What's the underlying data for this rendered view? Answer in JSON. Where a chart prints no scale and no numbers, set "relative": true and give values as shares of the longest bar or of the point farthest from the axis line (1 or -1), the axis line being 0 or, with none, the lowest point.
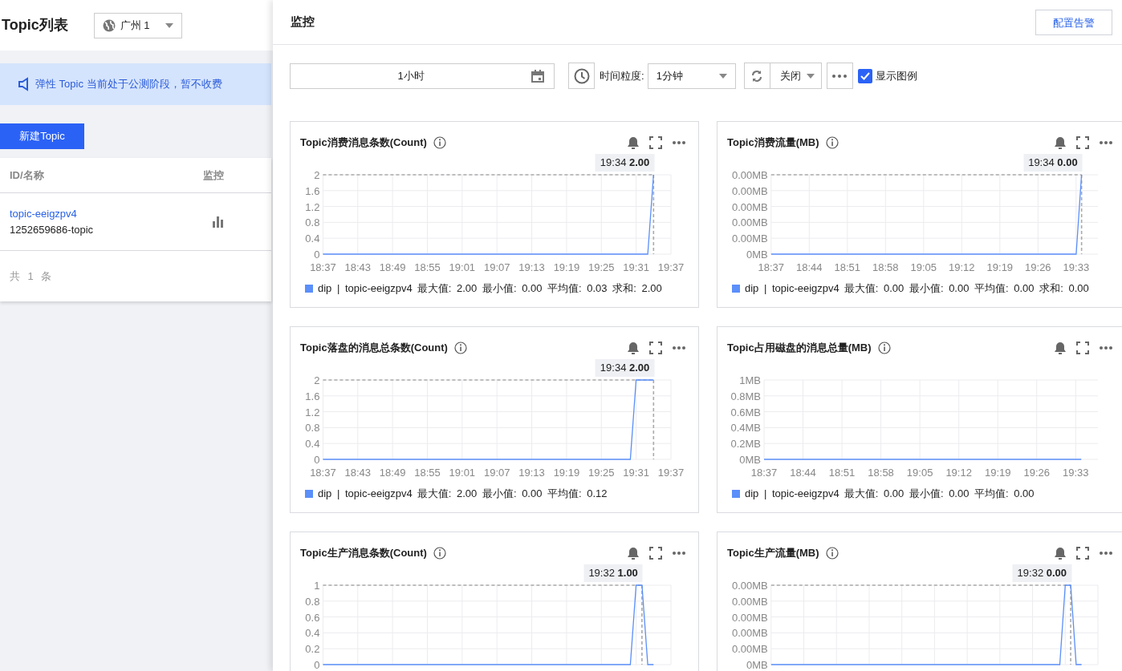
{
  "list_panel": {
    "title": "Topic列表",
    "region_select": {
      "value": "广州 1"
    },
    "notice": "弹性 Topic 当前处于公测阶段，暂不收费",
    "create_button": "新建Topic",
    "table": {
      "columns": [
        "ID/名称",
        "监控"
      ],
      "rows": [
        {
          "id": "topic-eeigzpv4",
          "name": "1252659686-topic"
        }
      ],
      "footer": "共 1 条"
    }
  },
  "monitor_panel": {
    "title": "监控",
    "alarm_button": "配置告警",
    "toolbar": {
      "time_range": "1小时",
      "granularity_label": "时间粒度:",
      "granularity": "1分钟",
      "refresh": "关闭",
      "show_legend": {
        "label": "显示图例",
        "checked": true
      }
    },
    "charts": [
      {
        "title": "Topic消费消息条数(Count)",
        "legend_stats": "最大值: 2.00 最小值: 0.00 平均值: 0.03 求和: 2.00",
        "chart_data": {
          "type": "line",
          "grid": true,
          "ylim": [
            0,
            2
          ],
          "yticks": [
            0,
            0.4,
            0.8,
            1.2,
            1.6,
            2
          ],
          "annotations": [
            "19:34 **2.00**"
          ],
          "categories": [
            "18:37",
            null,
            null,
            null,
            null,
            null,
            "18:43",
            null,
            null,
            null,
            null,
            null,
            "18:49",
            null,
            null,
            null,
            null,
            null,
            "18:55",
            null,
            null,
            null,
            null,
            null,
            "19:01",
            null,
            null,
            null,
            null,
            null,
            "19:07",
            null,
            null,
            null,
            null,
            null,
            "19:13",
            null,
            null,
            null,
            null,
            null,
            "19:19",
            null,
            null,
            null,
            null,
            null,
            "19:25",
            null,
            null,
            null,
            null,
            null,
            "19:31",
            null,
            null,
            null,
            null,
            null,
            "19:37"
          ],
          "series": [
            {
              "name": "dip | topic-eeigzpv4",
              "color": "#5b8ff9",
              "values": [
                0,
                0,
                0,
                0,
                0,
                0,
                0,
                0,
                0,
                0,
                0,
                0,
                0,
                0,
                0,
                0,
                0,
                0,
                0,
                0,
                0,
                0,
                0,
                0,
                0,
                0,
                0,
                0,
                0,
                0,
                0,
                0,
                0,
                0,
                0,
                0,
                0,
                0,
                0,
                0,
                0,
                0,
                0,
                0,
                0,
                0,
                0,
                0,
                0,
                0,
                0,
                0,
                0,
                0,
                0,
                0,
                0,
                2,
                null,
                null,
                null
              ]
            }
          ]
        }
      },
      {
        "title": "Topic消费流量(MB)",
        "legend_stats": "最大值: 0.00 最小值: 0.00 平均值: 0.00 求和: 0.00",
        "y_axis_labels": [
          "0.00MB",
          "0.00MB",
          "0.00MB",
          "0.00MB",
          "0.00MB",
          "0MB"
        ],
        "chart_data": {
          "type": "line",
          "grid": true,
          "relative": true,
          "annotations": [
            "19:34 **0.00**"
          ],
          "categories": [
            "18:37",
            null,
            null,
            null,
            null,
            null,
            null,
            "18:44",
            null,
            null,
            null,
            null,
            null,
            null,
            "18:51",
            null,
            null,
            null,
            null,
            null,
            null,
            "18:58",
            null,
            null,
            null,
            null,
            null,
            null,
            "19:05",
            null,
            null,
            null,
            null,
            null,
            null,
            "19:12",
            null,
            null,
            null,
            null,
            null,
            null,
            "19:19",
            null,
            null,
            null,
            null,
            null,
            null,
            "19:26",
            null,
            null,
            null,
            null,
            null,
            null,
            "19:33",
            null,
            null,
            null,
            null
          ],
          "series": [
            {
              "name": "dip | topic-eeigzpv4",
              "color": "#5b8ff9",
              "values": [
                0,
                0,
                0,
                0,
                0,
                0,
                0,
                0,
                0,
                0,
                0,
                0,
                0,
                0,
                0,
                0,
                0,
                0,
                0,
                0,
                0,
                0,
                0,
                0,
                0,
                0,
                0,
                0,
                0,
                0,
                0,
                0,
                0,
                0,
                0,
                0,
                0,
                0,
                0,
                0,
                0,
                0,
                0,
                0,
                0,
                0,
                0,
                0,
                0,
                0,
                0,
                0,
                0,
                0,
                0,
                0,
                0,
                1,
                null,
                null,
                null
              ]
            }
          ]
        }
      },
      {
        "title": "Topic落盘的消息总条数(Count)",
        "legend_stats": "最大值: 2.00 最小值: 0.00 平均值: 0.12",
        "chart_data": {
          "type": "line",
          "grid": true,
          "ylim": [
            0,
            2
          ],
          "yticks": [
            0,
            0.4,
            0.8,
            1.2,
            1.6,
            2
          ],
          "annotations": [
            "19:34 **2.00**"
          ],
          "categories": [
            "18:37",
            null,
            null,
            null,
            null,
            null,
            "18:43",
            null,
            null,
            null,
            null,
            null,
            "18:49",
            null,
            null,
            null,
            null,
            null,
            "18:55",
            null,
            null,
            null,
            null,
            null,
            "19:01",
            null,
            null,
            null,
            null,
            null,
            "19:07",
            null,
            null,
            null,
            null,
            null,
            "19:13",
            null,
            null,
            null,
            null,
            null,
            "19:19",
            null,
            null,
            null,
            null,
            null,
            "19:25",
            null,
            null,
            null,
            null,
            null,
            "19:31",
            null,
            null,
            null,
            null,
            null,
            "19:37"
          ],
          "series": [
            {
              "name": "dip | topic-eeigzpv4",
              "color": "#5b8ff9",
              "values": [
                0,
                0,
                0,
                0,
                0,
                0,
                0,
                0,
                0,
                0,
                0,
                0,
                0,
                0,
                0,
                0,
                0,
                0,
                0,
                0,
                0,
                0,
                0,
                0,
                0,
                0,
                0,
                0,
                0,
                0,
                0,
                0,
                0,
                0,
                0,
                0,
                0,
                0,
                0,
                0,
                0,
                0,
                0,
                0,
                0,
                0,
                0,
                0,
                0,
                0,
                0,
                0,
                0,
                0,
                2,
                2,
                2,
                2,
                null,
                null,
                null
              ]
            }
          ]
        }
      },
      {
        "title": "Topic占用磁盘的消息总量(MB)",
        "legend_stats": "最大值: 0.00 最小值: 0.00 平均值: 0.00",
        "chart_data": {
          "type": "line",
          "grid": true,
          "ylim": [
            0,
            1
          ],
          "yticks": [
            {
              "value": 0,
              "label": "0MB"
            },
            {
              "value": 0.2,
              "label": "0.2MB"
            },
            {
              "value": 0.4,
              "label": "0.4MB"
            },
            {
              "value": 0.6,
              "label": "0.6MB"
            },
            {
              "value": 0.8,
              "label": "0.8MB"
            },
            {
              "value": 1,
              "label": "1MB"
            }
          ],
          "categories": [
            "18:37",
            null,
            null,
            null,
            null,
            null,
            null,
            "18:44",
            null,
            null,
            null,
            null,
            null,
            null,
            "18:51",
            null,
            null,
            null,
            null,
            null,
            null,
            "18:58",
            null,
            null,
            null,
            null,
            null,
            null,
            "19:05",
            null,
            null,
            null,
            null,
            null,
            null,
            "19:12",
            null,
            null,
            null,
            null,
            null,
            null,
            "19:19",
            null,
            null,
            null,
            null,
            null,
            null,
            "19:26",
            null,
            null,
            null,
            null,
            null,
            null,
            "19:33",
            null,
            null,
            null,
            null
          ],
          "series": [
            {
              "name": "dip | topic-eeigzpv4",
              "color": "#5b8ff9",
              "values": [
                0,
                0,
                0,
                0,
                0,
                0,
                0,
                0,
                0,
                0,
                0,
                0,
                0,
                0,
                0,
                0,
                0,
                0,
                0,
                0,
                0,
                0,
                0,
                0,
                0,
                0,
                0,
                0,
                0,
                0,
                0,
                0,
                0,
                0,
                0,
                0,
                0,
                0,
                0,
                0,
                0,
                0,
                0,
                0,
                0,
                0,
                0,
                0,
                0,
                0,
                0,
                0,
                0,
                0,
                0,
                0,
                0,
                0,
                null,
                null,
                null
              ]
            }
          ]
        }
      },
      {
        "title": "Topic生产消息条数(Count)",
        "chart_data": {
          "type": "line",
          "grid": true,
          "ylim": [
            0,
            1
          ],
          "yticks": [
            0,
            0.2,
            0.4,
            0.6,
            0.8,
            1
          ],
          "annotations": [
            "19:32 **1.00**"
          ],
          "categories": [
            null,
            null,
            null,
            null,
            null,
            null,
            null,
            null,
            null,
            null,
            null,
            null,
            null,
            null,
            null,
            null,
            null,
            null,
            null,
            null,
            null,
            null,
            null,
            null,
            null,
            null,
            null,
            null,
            null,
            null,
            null,
            null,
            null,
            null,
            null,
            null,
            null,
            null,
            null,
            null,
            null,
            null,
            null,
            null,
            null,
            null,
            null,
            null,
            null,
            null,
            null,
            null,
            null,
            null,
            null,
            null,
            null,
            null,
            null,
            null,
            null
          ],
          "series": [
            {
              "color": "#5b8ff9",
              "values": [
                0,
                0,
                0,
                0,
                0,
                0,
                0,
                0,
                0,
                0,
                0,
                0,
                0,
                0,
                0,
                0,
                0,
                0,
                0,
                0,
                0,
                0,
                0,
                0,
                0,
                0,
                0,
                0,
                0,
                0,
                0,
                0,
                0,
                0,
                0,
                0,
                0,
                0,
                0,
                0,
                0,
                0,
                0,
                0,
                0,
                0,
                0,
                0,
                0,
                0,
                0,
                0,
                0,
                0,
                1,
                1,
                0,
                0,
                null,
                null,
                null
              ]
            }
          ]
        }
      },
      {
        "title": "Topic生产流量(MB)",
        "y_axis_labels": [
          "0.00MB",
          "0.00MB",
          "0.00MB",
          "0.00MB",
          "0.00MB",
          "0MB"
        ],
        "chart_data": {
          "type": "line",
          "grid": true,
          "relative": true,
          "annotations": [
            "19:32 **0.00**"
          ],
          "categories": [
            null,
            null,
            null,
            null,
            null,
            null,
            null,
            null,
            null,
            null,
            null,
            null,
            null,
            null,
            null,
            null,
            null,
            null,
            null,
            null,
            null,
            null,
            null,
            null,
            null,
            null,
            null,
            null,
            null,
            null,
            null,
            null,
            null,
            null,
            null,
            null,
            null,
            null,
            null,
            null,
            null,
            null,
            null,
            null,
            null,
            null,
            null,
            null,
            null,
            null,
            null,
            null,
            null,
            null,
            null,
            null,
            null,
            null,
            null,
            null,
            null
          ],
          "series": [
            {
              "color": "#5b8ff9",
              "values": [
                0,
                0,
                0,
                0,
                0,
                0,
                0,
                0,
                0,
                0,
                0,
                0,
                0,
                0,
                0,
                0,
                0,
                0,
                0,
                0,
                0,
                0,
                0,
                0,
                0,
                0,
                0,
                0,
                0,
                0,
                0,
                0,
                0,
                0,
                0,
                0,
                0,
                0,
                0,
                0,
                0,
                0,
                0,
                0,
                0,
                0,
                0,
                0,
                0,
                0,
                0,
                0,
                0,
                0,
                1,
                1,
                0,
                0,
                null,
                null,
                null
              ]
            }
          ]
        }
      }
    ]
  }
}
